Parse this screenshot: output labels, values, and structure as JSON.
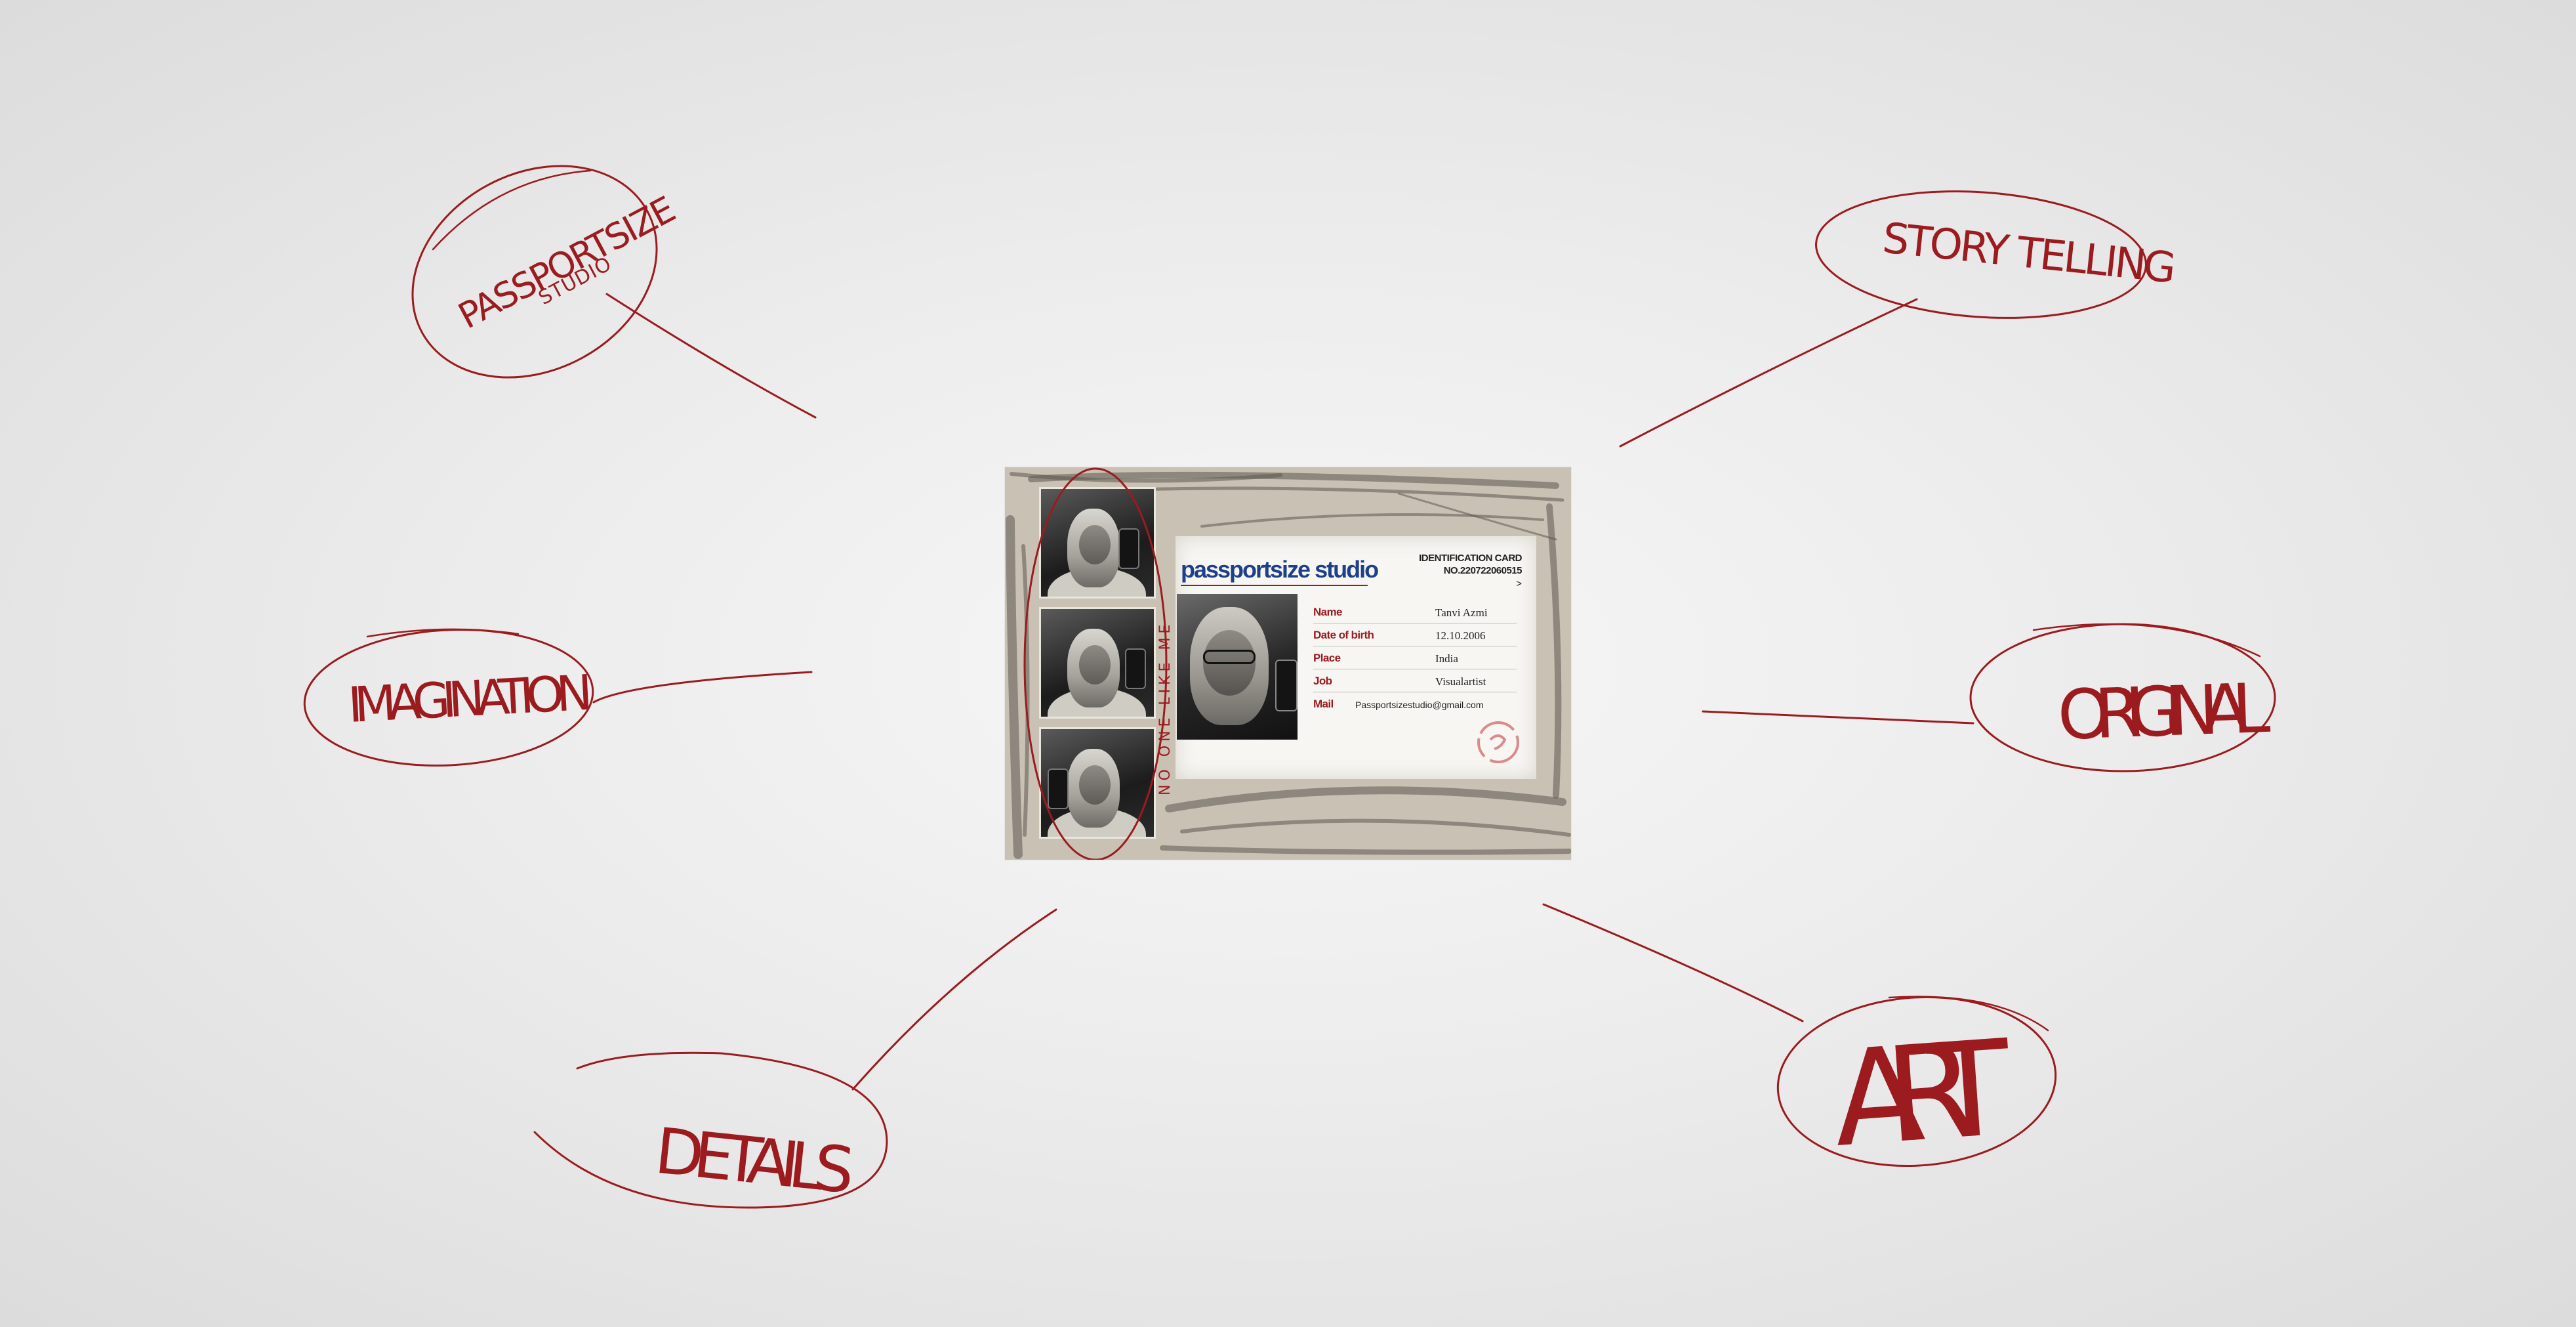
{
  "mindmap": {
    "nodes": {
      "passportsize": {
        "line1": "PASSPORTSIZE",
        "line2": "STUDIO"
      },
      "storytelling": "STORY TELLING",
      "imagination": "IMAGINATION",
      "original": "ORIGINAL",
      "details": "DETAILS",
      "art": "ART"
    }
  },
  "card": {
    "strip_text": "NO ONE LIKE ME",
    "brand": "passportsize studio",
    "id_title_line1": "IDENTIFICATION CARD",
    "id_title_line2": "NO.220722060515",
    "id_arrow": ">",
    "fields": [
      {
        "label": "Name",
        "value": "Tanvi  Azmi"
      },
      {
        "label": "Date of birth",
        "value": "12.10.2006"
      },
      {
        "label": "Place",
        "value": "India"
      },
      {
        "label": "Job",
        "value": "Visualartist"
      },
      {
        "label": "Mail",
        "value": "Passportsizestudio@gmail.com"
      }
    ]
  },
  "colors": {
    "ink": "#9b1b1f",
    "brand": "#1e3f8a",
    "card_bg": "#c9c2b4"
  }
}
